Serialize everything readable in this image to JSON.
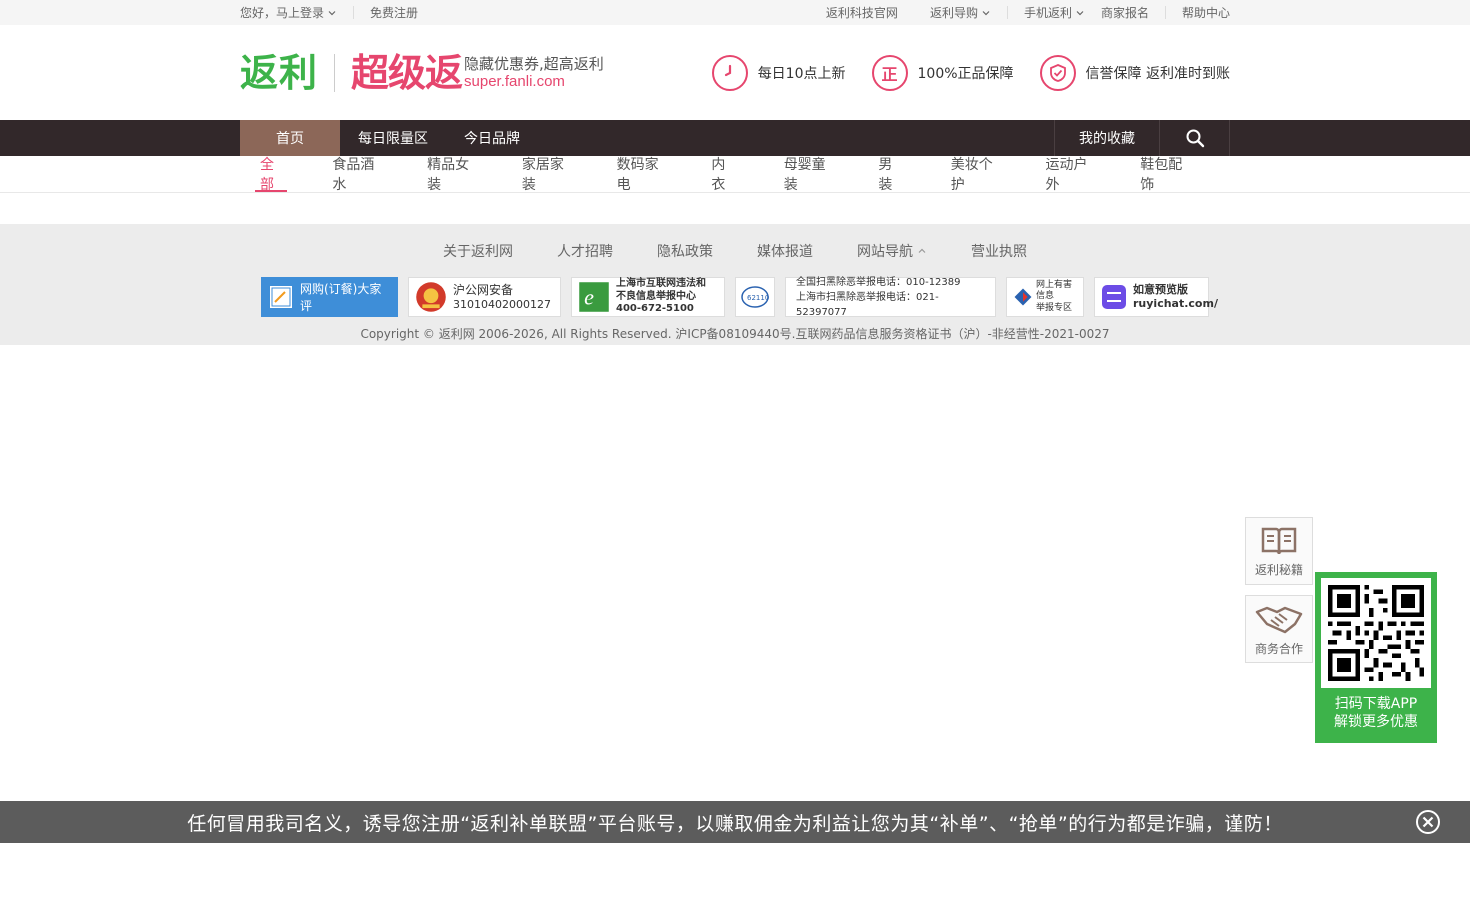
{
  "topbar": {
    "login": "您好，马上登录",
    "register": "免费注册",
    "right": [
      "返利科技官网",
      "返利导购",
      "手机返利",
      "商家报名",
      "帮助中心"
    ]
  },
  "header": {
    "logo_main": "返利",
    "logo_super": "超级返",
    "slogan": "隐藏优惠券,超高返利",
    "domain": "super.fanli.com",
    "promises": [
      {
        "icon": "clock-icon",
        "text": "每日10点上新"
      },
      {
        "icon": "genuine-icon",
        "glyph": "正",
        "text": "100%正品保障"
      },
      {
        "icon": "shield-check-icon",
        "text": "信誉保障 返利准时到账"
      }
    ]
  },
  "nav": {
    "items": [
      "首页",
      "每日限量区",
      "今日品牌"
    ],
    "favorites": "我的收藏"
  },
  "categories": [
    "全部",
    "食品酒水",
    "精品女装",
    "家居家装",
    "数码家电",
    "内衣",
    "母婴童装",
    "男装",
    "美妆个护",
    "运动户外",
    "鞋包配饰"
  ],
  "footer": {
    "links": [
      "关于返利网",
      "人才招聘",
      "隐私政策",
      "媒体报道",
      "网站导航",
      "营业执照"
    ],
    "badges": {
      "review": "网购(订餐)大家评",
      "police_title": "沪公网安备",
      "police_no": "31010402000127",
      "report_line1": "上海市互联网违法和",
      "report_line2": "不良信息举报中心",
      "report_phone": "400-672-5100",
      "cyber_110": "62110",
      "anti_line1": "全国扫黑除恶举报电话：010-12389",
      "anti_line2": "上海市扫黑除恶举报电话：021-52397077",
      "harmful_line1": "网上有害信息",
      "harmful_line2": "举报专区",
      "ruyi_name": "如意预览版",
      "ruyi_url": "ruyichat.com/"
    },
    "copyright": "Copyright © 返利网 2006-2026, All Rights Reserved. 沪ICP备08109440号.互联网药品信息服务资格证书（沪）-非经营性-2021-0027"
  },
  "side": {
    "guide": "返利秘籍",
    "business": "商务合作",
    "qr_line1": "扫码下载APP",
    "qr_line2": "解锁更多优惠"
  },
  "warning": "任何冒用我司名义，诱导您注册“返利补单联盟”平台账号，以赚取佣金为利益让您为其“补单”、“抢单”的行为都是诈骗，谨防！",
  "colors": {
    "brand_green": "#3db34a",
    "brand_pink": "#e6466e",
    "nav_bg": "#32282a",
    "nav_active": "#8c6758"
  }
}
